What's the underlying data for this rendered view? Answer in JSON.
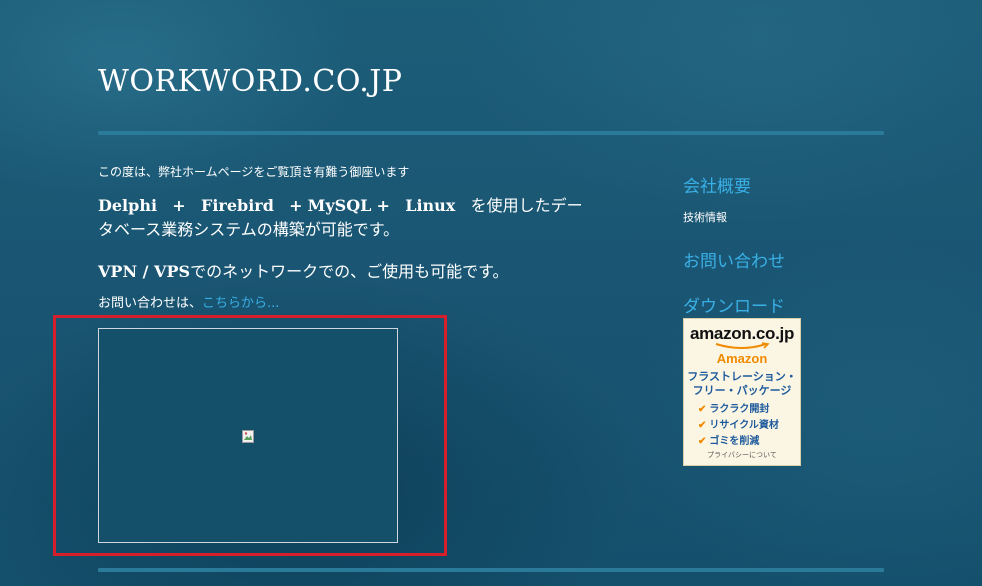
{
  "header": {
    "site_title": "WORKWORD.CO.JP"
  },
  "main": {
    "intro": "この度は、弊社ホームページをご覧頂き有難う御座います",
    "tech_delphi": "Delphi",
    "plus1": "+",
    "tech_firebird": "Firebird",
    "plus2": "+",
    "tech_mysql": "MySQL",
    "plus3": "+",
    "tech_linux": "Linux",
    "tech_suffix": "を使用したデータベース業務システムの構築が可能です。",
    "vpn_prefix": "VPN / VPS",
    "vpn_suffix": "でのネットワークでの、ご使用も可能です。",
    "contact_prefix": "お問い合わせは、",
    "contact_link": "こちらから..."
  },
  "sidebar": {
    "company_link": "会社概要",
    "company_sub": "技術情報",
    "inquiry_link": "お問い合わせ",
    "download_link": "ダウンロード"
  },
  "amazon_badge": {
    "logo": "amazon.co.jp",
    "brand": "Amazon",
    "headline_line1": "フラストレーション・",
    "headline_line2": "フリー・パッケージ",
    "features": [
      "ラクラク開封",
      "リサイクル資材",
      "ゴミを削減"
    ],
    "privacy": "プライバシーについて"
  },
  "colors": {
    "link": "#3ab0e6",
    "highlight": "#d71f2b",
    "background": "#1a5673",
    "rule": "#2a7a99"
  }
}
